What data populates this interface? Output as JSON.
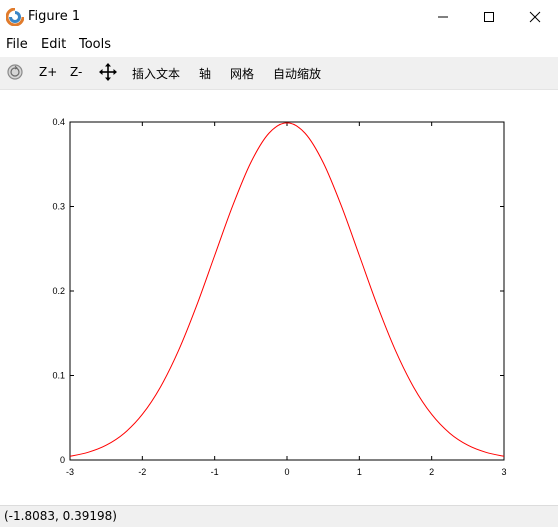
{
  "window": {
    "title": "Figure 1"
  },
  "menu": {
    "file": "File",
    "edit": "Edit",
    "tools": "Tools"
  },
  "toolbar": {
    "zoom_in": "Z+",
    "zoom_out": "Z-",
    "insert_text": "插入文本",
    "axes": "轴",
    "grid": "网格",
    "autoscale": "自动缩放"
  },
  "status": {
    "coords": "(-1.8083, 0.39198)"
  },
  "colors": {
    "line": "#ff0000",
    "axes": "#000000",
    "toolbar_bg": "#f0f0f0"
  },
  "chart_data": {
    "type": "line",
    "title": "",
    "xlabel": "",
    "ylabel": "",
    "xlim": [
      -3,
      3
    ],
    "ylim": [
      0,
      0.4
    ],
    "xticks": [
      -3,
      -2,
      -1,
      0,
      1,
      2,
      3
    ],
    "yticks": [
      0,
      0.1,
      0.2,
      0.3,
      0.4
    ],
    "xtick_labels": [
      "-3",
      "-2",
      "-1",
      "0",
      "1",
      "2",
      "3"
    ],
    "ytick_labels": [
      "0",
      "0.1",
      "0.2",
      "0.3",
      "0.4"
    ],
    "grid": false,
    "series": [
      {
        "color": "#ff0000",
        "x": [
          -3,
          -2.75,
          -2.5,
          -2.25,
          -2,
          -1.75,
          -1.5,
          -1.25,
          -1,
          -0.75,
          -0.5,
          -0.25,
          0,
          0.25,
          0.5,
          0.75,
          1,
          1.25,
          1.5,
          1.75,
          2,
          2.25,
          2.5,
          2.75,
          3
        ],
        "y": [
          0.0044,
          0.0091,
          0.0175,
          0.0317,
          0.054,
          0.0863,
          0.1295,
          0.1826,
          0.242,
          0.3011,
          0.3521,
          0.3867,
          0.3989,
          0.3867,
          0.3521,
          0.3011,
          0.242,
          0.1826,
          0.1295,
          0.0863,
          0.054,
          0.0317,
          0.0175,
          0.0091,
          0.0044
        ]
      }
    ]
  }
}
